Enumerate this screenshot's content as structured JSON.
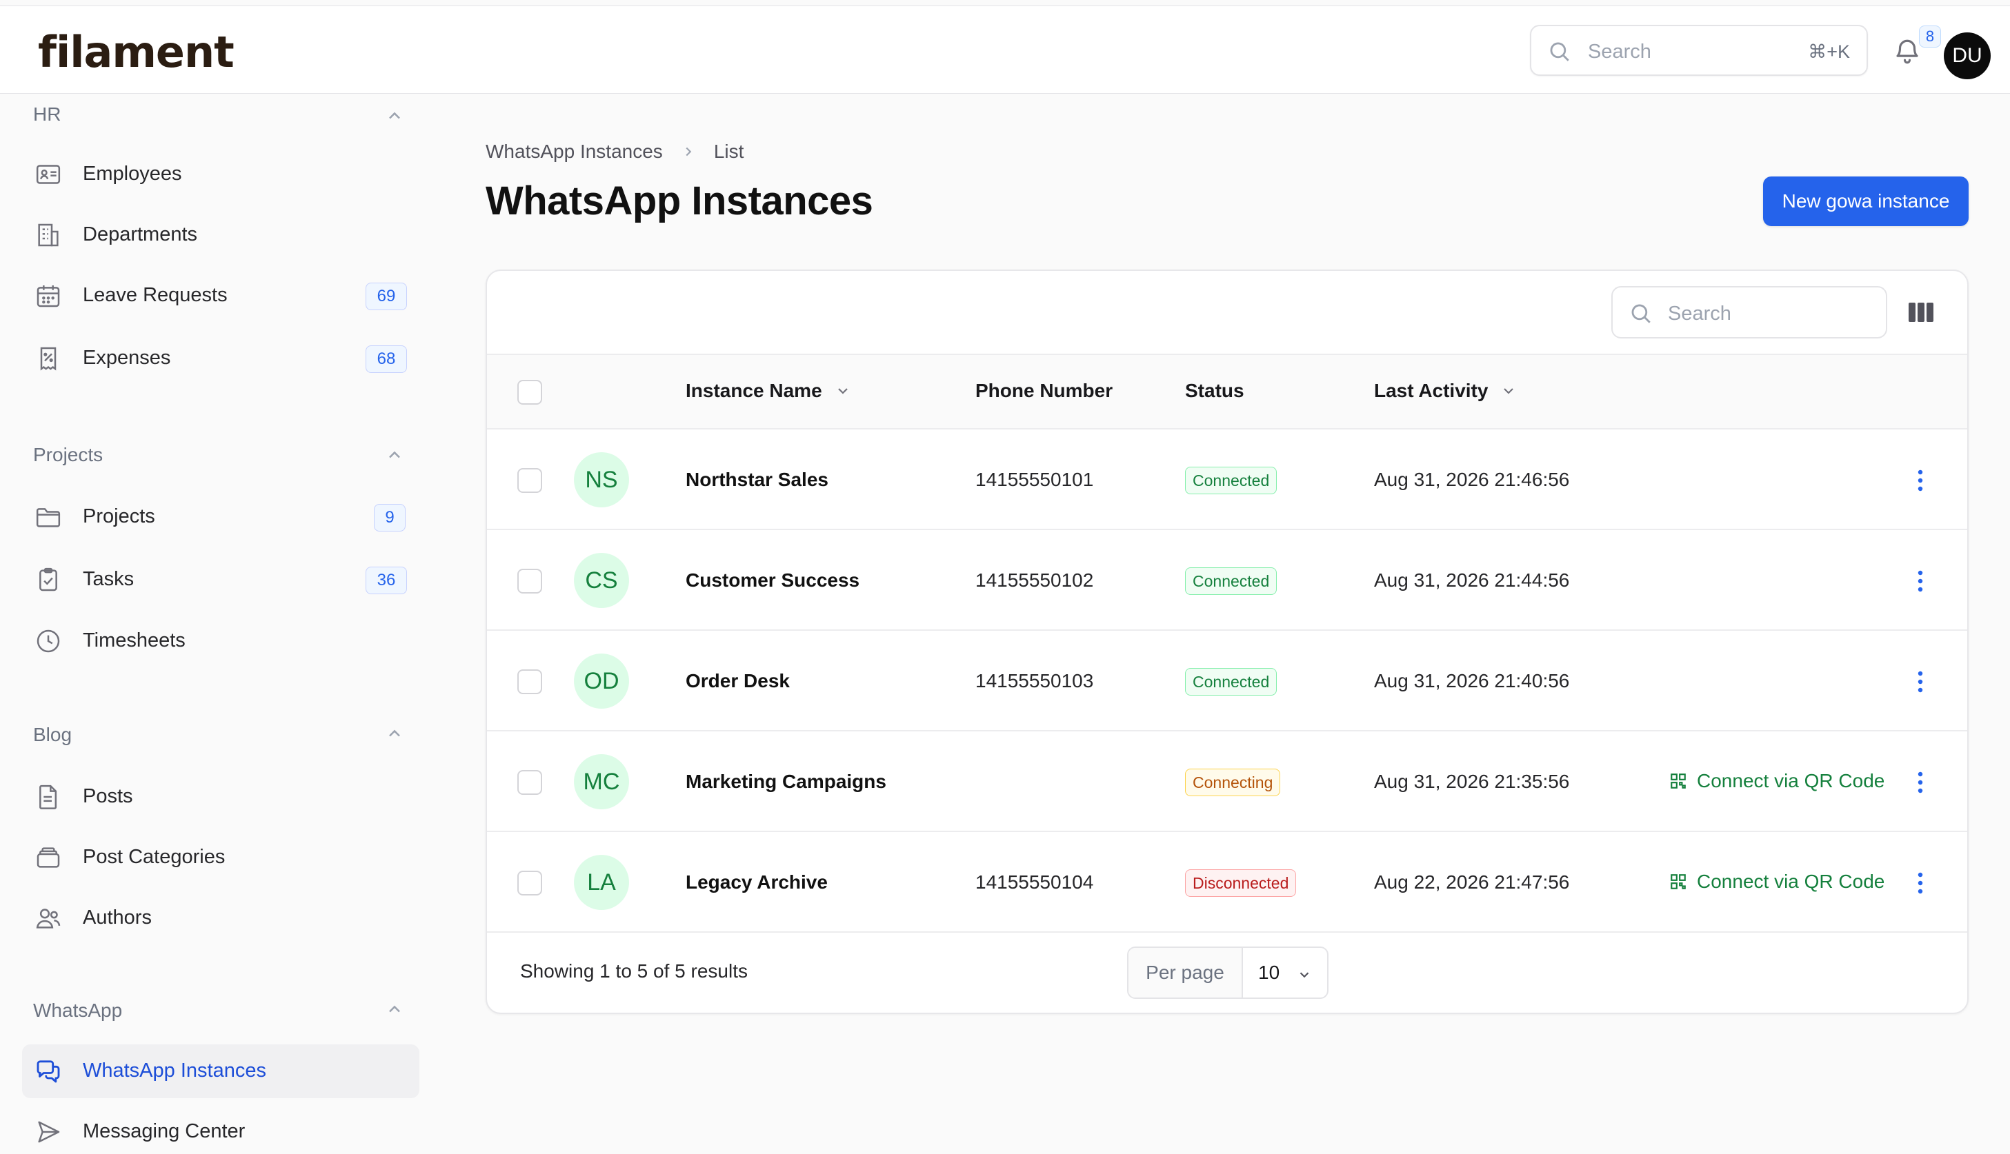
{
  "app": {
    "logo": "filament"
  },
  "header": {
    "search_placeholder": "Search",
    "search_shortcut": "⌘+K",
    "notification_count": "8",
    "user_initials": "DU"
  },
  "sidebar": {
    "groups": [
      {
        "title": "HR",
        "items": [
          {
            "label": "Employees",
            "icon": "id-card-icon"
          },
          {
            "label": "Departments",
            "icon": "building-icon"
          },
          {
            "label": "Leave Requests",
            "icon": "calendar-icon",
            "badge": "69"
          },
          {
            "label": "Expenses",
            "icon": "receipt-percent-icon",
            "badge": "68"
          }
        ]
      },
      {
        "title": "Projects",
        "items": [
          {
            "label": "Projects",
            "icon": "folder-icon",
            "badge": "9"
          },
          {
            "label": "Tasks",
            "icon": "clipboard-check-icon",
            "badge": "36"
          },
          {
            "label": "Timesheets",
            "icon": "clock-icon"
          }
        ]
      },
      {
        "title": "Blog",
        "items": [
          {
            "label": "Posts",
            "icon": "document-icon"
          },
          {
            "label": "Post Categories",
            "icon": "stack-icon"
          },
          {
            "label": "Authors",
            "icon": "users-icon"
          }
        ]
      },
      {
        "title": "WhatsApp",
        "items": [
          {
            "label": "WhatsApp Instances",
            "icon": "chat-bubbles-icon",
            "active": true
          },
          {
            "label": "Messaging Center",
            "icon": "paper-airplane-icon"
          }
        ]
      }
    ]
  },
  "breadcrumb": {
    "parent": "WhatsApp Instances",
    "current": "List"
  },
  "page": {
    "title": "WhatsApp Instances",
    "new_button": "New gowa instance"
  },
  "table": {
    "search_placeholder": "Search",
    "columns": {
      "instance_name": "Instance Name",
      "phone_number": "Phone Number",
      "status": "Status",
      "last_activity": "Last Activity"
    },
    "rows": [
      {
        "initials": "NS",
        "name": "Northstar Sales",
        "phone": "14155550101",
        "status": "Connected",
        "status_type": "ok",
        "last_activity": "Aug 31, 2026 21:46:56",
        "action": ""
      },
      {
        "initials": "CS",
        "name": "Customer Success",
        "phone": "14155550102",
        "status": "Connected",
        "status_type": "ok",
        "last_activity": "Aug 31, 2026 21:44:56",
        "action": ""
      },
      {
        "initials": "OD",
        "name": "Order Desk",
        "phone": "14155550103",
        "status": "Connected",
        "status_type": "ok",
        "last_activity": "Aug 31, 2026 21:40:56",
        "action": ""
      },
      {
        "initials": "MC",
        "name": "Marketing Campaigns",
        "phone": "",
        "status": "Connecting",
        "status_type": "warn",
        "last_activity": "Aug 31, 2026 21:35:56",
        "action": "Connect via QR Code"
      },
      {
        "initials": "LA",
        "name": "Legacy Archive",
        "phone": "14155550104",
        "status": "Disconnected",
        "status_type": "bad",
        "last_activity": "Aug 22, 2026 21:47:56",
        "action": "Connect via QR Code"
      }
    ],
    "footer": {
      "summary": "Showing 1 to 5 of 5 results",
      "per_page_label": "Per page",
      "per_page_value": "10"
    }
  },
  "colors": {
    "primary": "#2563eb",
    "success": "#15803d",
    "warning": "#b45309",
    "danger": "#b91c1c"
  }
}
